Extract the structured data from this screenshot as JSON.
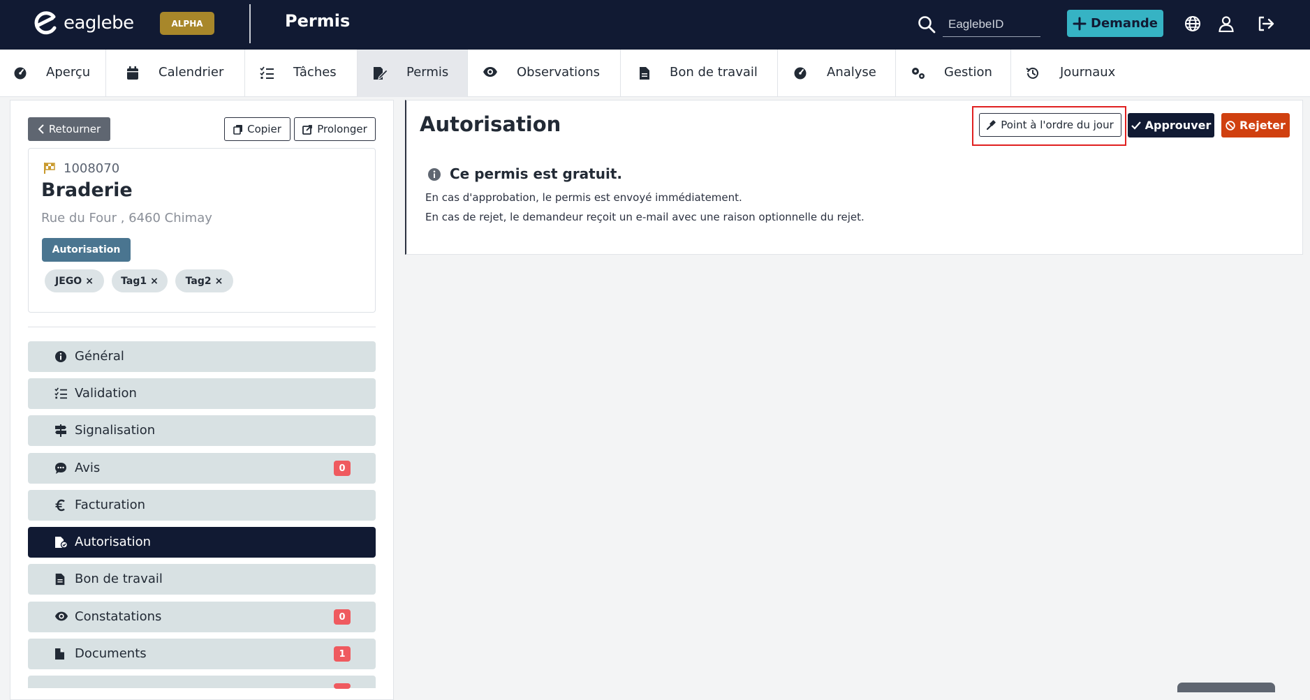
{
  "header": {
    "logo_text": "eaglebe",
    "badge": "ALPHA",
    "app_title": "Permis",
    "search_placeholder": "EaglebeID",
    "new_request_label": "Demande",
    "icons": [
      "globe-icon",
      "user-icon",
      "logout-icon"
    ]
  },
  "tabs": [
    {
      "label": "Aperçu",
      "icon": "dashboard-icon"
    },
    {
      "label": "Calendrier",
      "icon": "calendar-icon"
    },
    {
      "label": "Tâches",
      "icon": "tasks-icon"
    },
    {
      "label": "Permis",
      "icon": "permit-icon",
      "active": true
    },
    {
      "label": "Observations",
      "icon": "eye-icon"
    },
    {
      "label": "Bon de travail",
      "icon": "document-icon"
    },
    {
      "label": "Analyse",
      "icon": "dashboard-icon"
    },
    {
      "label": "Gestion",
      "icon": "gears-icon"
    },
    {
      "label": "Journaux",
      "icon": "history-icon"
    }
  ],
  "sidebar": {
    "back_label": "Retourner",
    "copy_label": "Copier",
    "extend_label": "Prolonger",
    "permit": {
      "number": "1008070",
      "title": "Braderie",
      "address": "Rue du Four , 6460 Chimay",
      "type_badge": "Autorisation",
      "tags": [
        "JEGO",
        "Tag1",
        "Tag2"
      ]
    },
    "menu": [
      {
        "label": "Général",
        "icon": "info-icon"
      },
      {
        "label": "Validation",
        "icon": "tasks-icon"
      },
      {
        "label": "Signalisation",
        "icon": "signpost-icon"
      },
      {
        "label": "Avis",
        "icon": "comment-icon",
        "count": "0"
      },
      {
        "label": "Facturation",
        "icon": "euro-icon"
      },
      {
        "label": "Autorisation",
        "icon": "file-check-icon",
        "active": true
      },
      {
        "label": "Bon de travail",
        "icon": "document-icon"
      },
      {
        "label": "Constatations",
        "icon": "eye-icon",
        "count": "0"
      },
      {
        "label": "Documents",
        "icon": "file-icon",
        "count": "1"
      }
    ]
  },
  "main": {
    "title": "Autorisation",
    "agenda_label": "Point à l'ordre du jour",
    "approve_label": "Approuver",
    "reject_label": "Rejeter",
    "info_title": "Ce permis est gratuit.",
    "info_lines": [
      "En cas d'approbation, le permis est envoyé immédiatement.",
      "En cas de rejet, le demandeur reçoit un e-mail avec une raison optionnelle du rejet."
    ]
  },
  "colors": {
    "navy": "#111a33",
    "teal": "#36b3c4",
    "alpha_gold": "#a8872a",
    "reject": "#d0400f",
    "badge_red": "#ef5a5f",
    "tag_bg": "#dce3e6",
    "menu_bg": "#d8e1e3",
    "type_badge": "#4a7590"
  }
}
